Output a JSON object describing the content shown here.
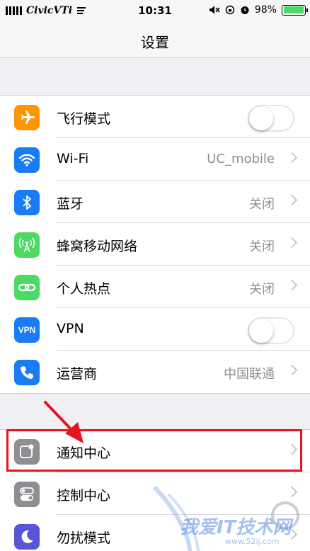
{
  "status_bar": {
    "carrier": "CivicVTi",
    "time": "10:31",
    "battery": "98%",
    "battery_level": 0.98
  },
  "nav": {
    "title": "设置"
  },
  "group1": [
    {
      "label": "飞行模式",
      "icon": "airplane-icon",
      "color": "#ff9500",
      "control": "toggle",
      "on": false
    },
    {
      "label": "Wi-Fi",
      "value": "UC_mobile",
      "icon": "wifi-icon",
      "color": "#1a7cf4",
      "control": "chevron"
    },
    {
      "label": "蓝牙",
      "value": "关闭",
      "icon": "bluetooth-icon",
      "color": "#1a7cf4",
      "control": "chevron"
    },
    {
      "label": "蜂窝移动网络",
      "value": "关闭",
      "icon": "cellular-icon",
      "color": "#4cd964",
      "control": "chevron"
    },
    {
      "label": "个人热点",
      "value": "关闭",
      "icon": "hotspot-icon",
      "color": "#4cd964",
      "control": "chevron"
    },
    {
      "label": "VPN",
      "icon_text": "VPN",
      "icon": "vpn-icon",
      "color": "#1a7cf4",
      "control": "toggle",
      "on": false
    },
    {
      "label": "运营商",
      "value": "中国联通",
      "icon": "phone-icon",
      "color": "#1a7cf4",
      "control": "chevron"
    }
  ],
  "group2": [
    {
      "label": "通知中心",
      "icon": "notification-center-icon",
      "color": "#8e8e93",
      "control": "chevron"
    },
    {
      "label": "控制中心",
      "icon": "control-center-icon",
      "color": "#8e8e93",
      "control": "chevron"
    },
    {
      "label": "勿扰模式",
      "icon": "moon-icon",
      "color": "#5856d6",
      "control": "chevron"
    }
  ],
  "watermark": {
    "text": "我爱IT技术网",
    "url": "www.52ij.com"
  },
  "colors": {
    "highlight": "#e8131f",
    "toggle_off": "#e5e5ea"
  }
}
